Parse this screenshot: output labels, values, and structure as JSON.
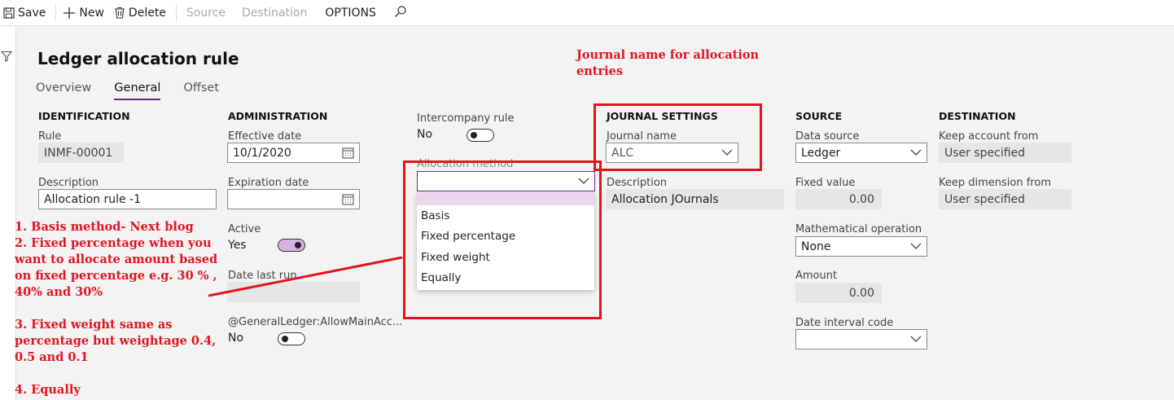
{
  "toolbar": {
    "save": "Save",
    "new": "New",
    "delete": "Delete",
    "source": "Source",
    "destination": "Destination",
    "options": "OPTIONS"
  },
  "page": {
    "title": "Ledger allocation rule",
    "tabs": [
      "Overview",
      "General",
      "Offset"
    ]
  },
  "identification": {
    "header": "IDENTIFICATION",
    "rule_label": "Rule",
    "rule_value": "INMF-00001",
    "description_label": "Description",
    "description_value": "Allocation rule -1"
  },
  "administration": {
    "header": "ADMINISTRATION",
    "effective_label": "Effective date",
    "effective_value": "10/1/2020",
    "expiration_label": "Expiration date",
    "expiration_value": "",
    "active_label": "Active",
    "active_value": "Yes",
    "last_run_label": "Date last run",
    "last_run_value": "",
    "allow_label": "@GeneralLedger:AllowMainAcc...",
    "allow_value": "No"
  },
  "intercompany": {
    "label": "Intercompany rule",
    "value": "No",
    "allocation_label": "Allocation method",
    "allocation_value": "",
    "options": [
      "",
      "Basis",
      "Fixed percentage",
      "Fixed weight",
      "Equally"
    ]
  },
  "journal_settings": {
    "header": "JOURNAL SETTINGS",
    "journal_label": "Journal name",
    "journal_value": "ALC",
    "description_label": "Description",
    "description_value": "Allocation JOurnals"
  },
  "source": {
    "header": "SOURCE",
    "data_source_label": "Data source",
    "data_source_value": "Ledger",
    "fixed_value_label": "Fixed value",
    "fixed_value_value": "0.00",
    "math_label": "Mathematical operation",
    "math_value": "None",
    "amount_label": "Amount",
    "amount_value": "0.00",
    "date_interval_label": "Date interval code",
    "date_interval_value": ""
  },
  "destination": {
    "header": "DESTINATION",
    "keep_account_label": "Keep account from",
    "keep_account_value": "User specified",
    "keep_dimension_label": "Keep dimension from",
    "keep_dimension_value": "User specified"
  },
  "annotations": {
    "journal_note_1": "Journal name for allocation",
    "journal_note_2": "entries",
    "left_notes": [
      "1. Basis method- Next blog",
      "2. Fixed percentage when you",
      "want to allocate amount based",
      "on fixed percentage e.g. 30 % ,",
      " 40% and 30%",
      "",
      "3. Fixed weight same as",
      "percentage but weightage 0.4,",
      "0.5 and 0.1",
      "",
      "4. Equally"
    ]
  },
  "colors": {
    "accent": "#6b2c80",
    "annotation": "#e3141f",
    "toggle_on": "#d6b3df"
  }
}
